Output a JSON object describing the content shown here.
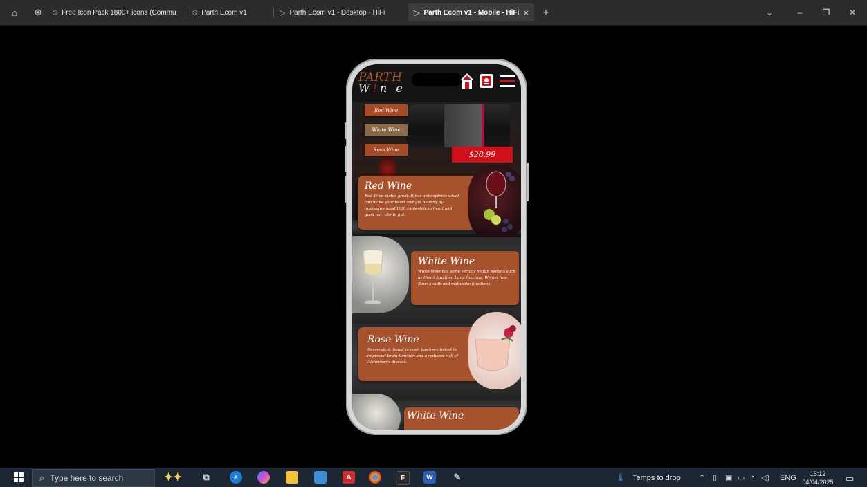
{
  "browser": {
    "tabs": [
      {
        "label": "Free Icon Pack 1800+ icons (Commu",
        "active": false
      },
      {
        "label": "Parth Ecom v1",
        "active": false
      },
      {
        "label": "Parth Ecom v1 - Desktop - HiFi",
        "active": false
      },
      {
        "label": "Parth Ecom v1 - Mobile - HiFi",
        "active": true
      }
    ],
    "new_tab": "+",
    "close_tab": "×"
  },
  "app": {
    "logo_top": "PARTH",
    "logo_w": "W",
    "logo_bang": "!",
    "logo_rest": "n e",
    "hero": {
      "categories": [
        "Red Wine",
        "White Wine",
        "Rose Wine"
      ],
      "price": "$28.99"
    },
    "sections": [
      {
        "title": "Red Wine",
        "text": "Red Wine tastes great. It has antioxidents which can make your heart and gut healthy by improving good HDL cholestole in heart and good microbe in gut."
      },
      {
        "title": "White Wine",
        "text": "White Wine has some serious health benifits such as Heart function, Lung function, Weight loss, Bone health and matabolic functions."
      },
      {
        "title": "Rose Wine",
        "text": "Resveratrol, found in rosé, has been linked to improved brain function and a reduced risk of Alzheimer's disease."
      },
      {
        "title": "White Wine",
        "text": ""
      }
    ]
  },
  "taskbar": {
    "search_placeholder": "Type here to search",
    "weather": "Temps to drop",
    "language": "ENG",
    "time": "16:12",
    "date": "04/04/2025"
  },
  "colors": {
    "card": "#a5522d",
    "price": "#d0101a",
    "logo_accent": "#b1572c"
  }
}
